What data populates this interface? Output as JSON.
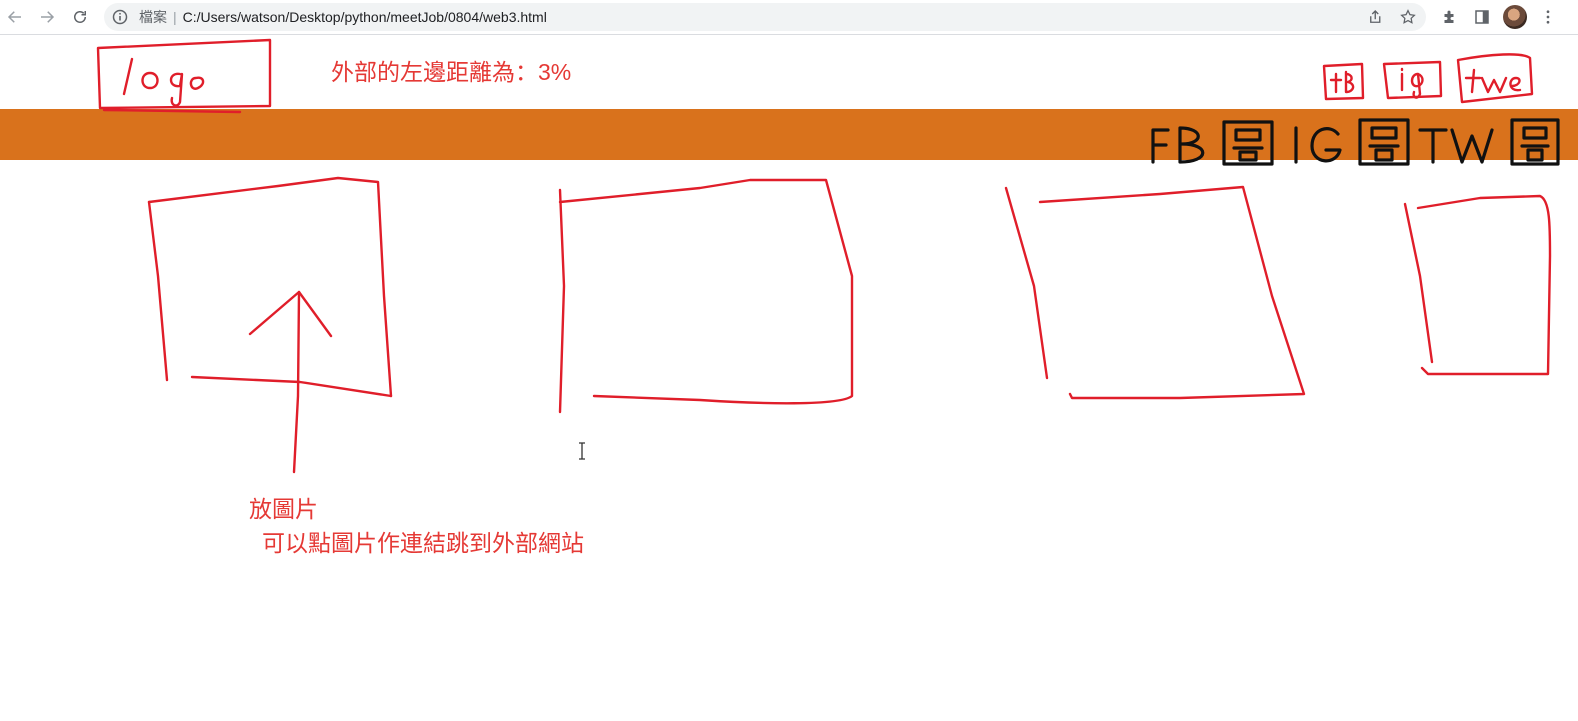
{
  "browser": {
    "security_label": "檔案",
    "url": "C:/Users/watson/Desktop/python/meetJob/0804/web3.html"
  },
  "page": {
    "margin_note": "外部的左邊距離為：3%",
    "header": {
      "logo_text": "logo",
      "social_icons": [
        "fb",
        "ig",
        "twe"
      ],
      "banner_labels": [
        "FB",
        "圖",
        "IG",
        "圖",
        "TW",
        "圖"
      ]
    },
    "image_caption": "放圖片",
    "link_caption": "可以點圖片作連結跳到外部網站"
  },
  "colors": {
    "accent_orange": "#d9721c",
    "annotation_red": "#e53935",
    "banner_text": "#111111"
  }
}
